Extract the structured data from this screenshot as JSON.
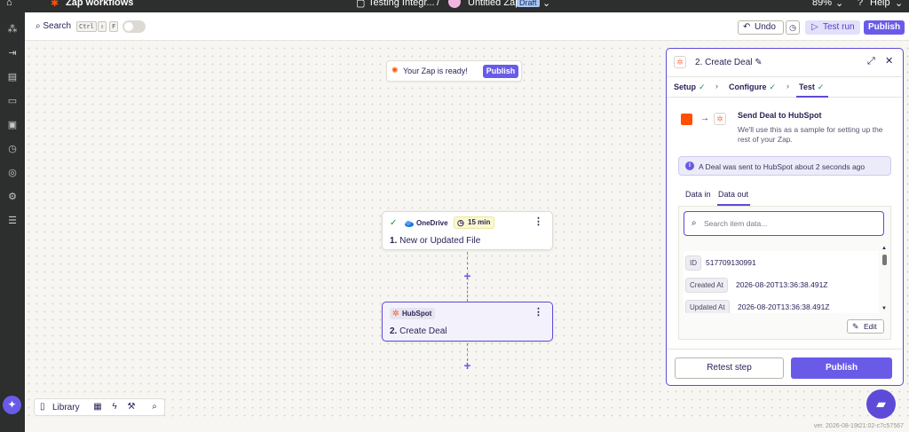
{
  "topbar": {
    "app_name": "Zap workflows",
    "folder": "Testing Integr...",
    "separator": "/",
    "zap_name": "Untitled Zap",
    "status_badge": "Draft",
    "zoom": "89%",
    "help": "Help"
  },
  "toolbar": {
    "search_label": "Search",
    "shortcut_keys": [
      "Ctrl",
      "⇧",
      "F"
    ],
    "undo_label": "Undo",
    "test_run_label": "Test run",
    "publish_label": "Publish"
  },
  "canvas": {
    "ready_text": "Your Zap is ready!",
    "ready_publish": "Publish",
    "step1": {
      "app": "OneDrive",
      "badge": "15 min",
      "number": "1.",
      "title": "New or Updated File"
    },
    "step2": {
      "app": "HubSpot",
      "number": "2.",
      "title": "Create Deal"
    }
  },
  "bottom": {
    "library_label": "Library"
  },
  "version": "ver. 2026-08-19t21:02-c7c57567",
  "panel": {
    "title": "2. Create Deal",
    "tabs": [
      "Setup",
      "Configure",
      "Test"
    ],
    "send_title": "Send Deal to HubSpot",
    "send_desc": "We'll use this as a sample for setting up the rest of your Zap.",
    "info": "A Deal was sent to HubSpot about 2 seconds ago",
    "data_tabs": [
      "Data in",
      "Data out"
    ],
    "search_placeholder": "Search item data...",
    "rows": [
      {
        "key": "ID",
        "value": "517709130991"
      },
      {
        "key": "Created At",
        "value": "2026-08-20T13:36:38.491Z"
      },
      {
        "key": "Updated At",
        "value": "2026-08-20T13:36:38.491Z"
      }
    ],
    "edit_label": "Edit",
    "retest_label": "Retest step",
    "publish_label": "Publish"
  },
  "colors": {
    "accent": "#695be8",
    "zapier_orange": "#ff4f00",
    "hubspot": "#ff7a59",
    "success": "#1f8a4c"
  }
}
